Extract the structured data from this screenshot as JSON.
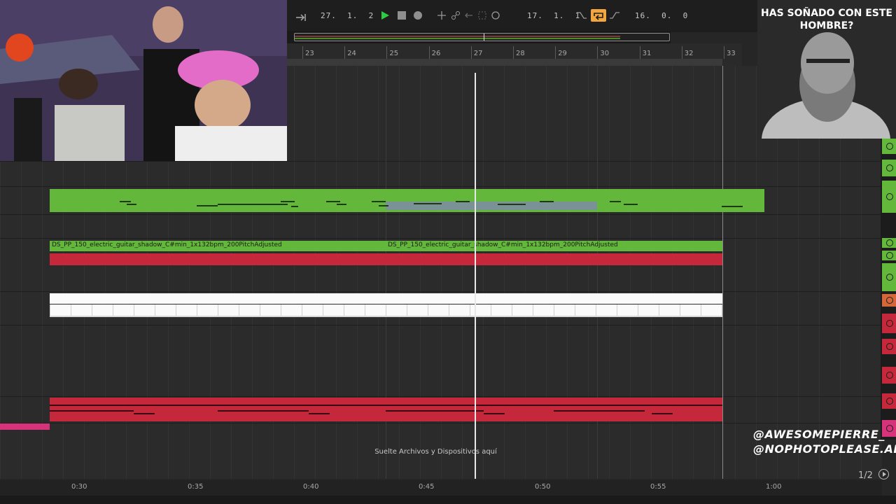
{
  "transport": {
    "arrangement_position": "27.  1.  2",
    "loop_start": "17.  1.  1",
    "loop_length": "16.  0.  0"
  },
  "ruler": {
    "bars": [
      "23",
      "24",
      "25",
      "26",
      "27",
      "28",
      "29",
      "30",
      "31",
      "32",
      "33"
    ]
  },
  "tracks": [
    {
      "kind": "midi",
      "color": "#63b73a"
    },
    {
      "kind": "audio",
      "color": "#63b73a",
      "clips": [
        "DS_PP_150_electric_guitar_shadow_C#min_1x132bpm_200PitchAdjusted",
        "DS_PP_150_electric_guitar_shadow_C#min_1x132bpm_200PitchAdjusted"
      ]
    },
    {
      "kind": "audio",
      "color": "#c5283a"
    },
    {
      "kind": "midi",
      "color": "#f5f5f5"
    },
    {
      "kind": "midi",
      "color": "#c5283a"
    }
  ],
  "drop_hint": "Suelte Archivos y Dispositivos aquí",
  "timeline": {
    "labels": [
      "0:30",
      "0:35",
      "0:40",
      "0:45",
      "0:50",
      "0:55",
      "1:00"
    ]
  },
  "overlay": {
    "promo_title": "HAS SOÑADO CON ESTE HOMBRE?",
    "social": [
      "@AWESOMEPIERRE_",
      "@NOPHOTOPLEASE.ALS"
    ],
    "page": "1/2"
  },
  "colors": {
    "green": "#63b73a",
    "red": "#c5283a",
    "play": "#2ecc40",
    "loop_orange": "#f3a53f",
    "pink": "#d6337b"
  }
}
